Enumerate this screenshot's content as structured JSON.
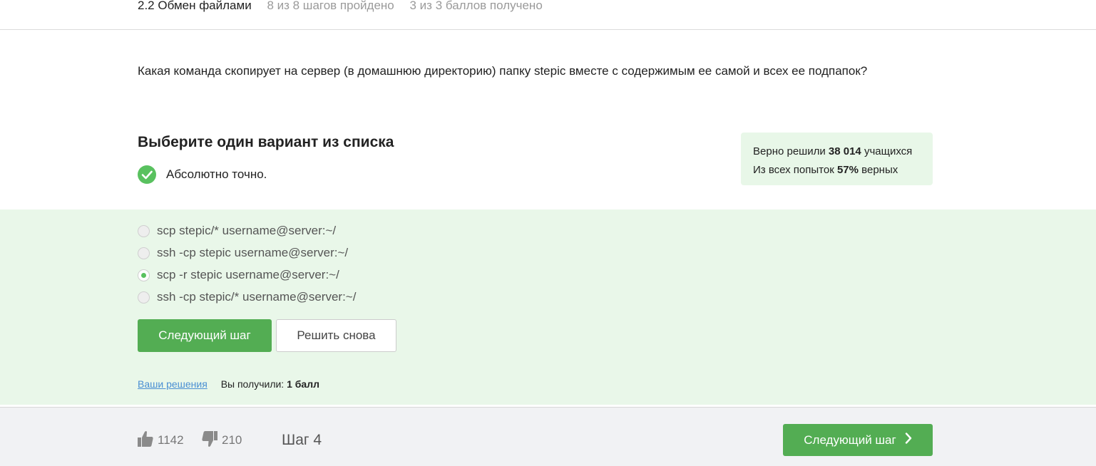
{
  "header": {
    "lesson_title": "2.2 Обмен файлами",
    "progress": "8 из 8 шагов пройдено",
    "score": "3 из 3 баллов  получено"
  },
  "question": {
    "text": "Какая команда скопирует на сервер (в домашнюю директорию) папку stepic вместе с содержимым ее самой и всех ее подпапок?"
  },
  "quiz": {
    "title": "Выберите один вариант из списка",
    "feedback": "Абсолютно точно.",
    "options": [
      {
        "label": "scp stepic/* username@server:~/",
        "selected": false
      },
      {
        "label": "ssh -cp stepic username@server:~/",
        "selected": false
      },
      {
        "label": "scp -r stepic username@server:~/",
        "selected": true
      },
      {
        "label": "ssh -cp stepic/* username@server:~/",
        "selected": false
      }
    ],
    "next_button": "Следующий шаг",
    "retry_button": "Решить снова",
    "solutions_link": "Ваши решения",
    "received_label": "Вы получили:",
    "received_value": "1 балл"
  },
  "stats": {
    "solved_prefix": "Верно решили",
    "solved_count": "38 014",
    "solved_suffix": "учащихся",
    "attempts_prefix": "Из всех попыток",
    "attempts_percent": "57%",
    "attempts_suffix": "верных"
  },
  "footer": {
    "likes": "1142",
    "dislikes": "210",
    "step": "Шаг 4",
    "next_button": "Следующий шаг"
  },
  "colors": {
    "accent_green": "#53ad53",
    "success_green": "#59c15f",
    "section_bg": "#e9f7e9",
    "link_blue": "#4a8fd3"
  }
}
